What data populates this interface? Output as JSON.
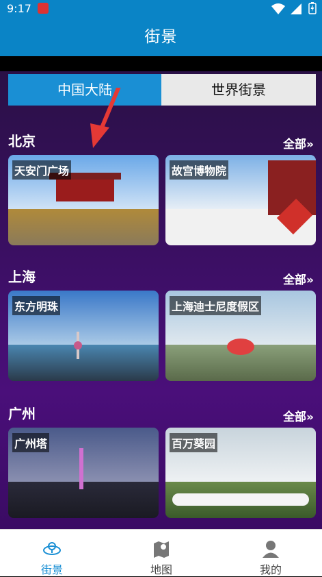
{
  "status_bar": {
    "time": "9:17"
  },
  "header": {
    "title": "街景"
  },
  "tabs": [
    {
      "label": "中国大陆",
      "active": true
    },
    {
      "label": "世界街景",
      "active": false
    }
  ],
  "sections": [
    {
      "city": "北京",
      "all_label": "全部»",
      "cards": [
        {
          "label": "天安门广场"
        },
        {
          "label": "故宫博物院"
        }
      ]
    },
    {
      "city": "上海",
      "all_label": "全部»",
      "cards": [
        {
          "label": "东方明珠"
        },
        {
          "label": "上海迪士尼度假区"
        }
      ]
    },
    {
      "city": "广州",
      "all_label": "全部»",
      "cards": [
        {
          "label": "广州塔"
        },
        {
          "label": "百万葵园"
        }
      ]
    }
  ],
  "bottom_nav": [
    {
      "label": "街景",
      "icon": "street-view-icon",
      "active": true
    },
    {
      "label": "地图",
      "icon": "map-icon",
      "active": false
    },
    {
      "label": "我的",
      "icon": "user-icon",
      "active": false
    }
  ],
  "colors": {
    "primary": "#0a84c6",
    "tab_active": "#1a8fd4",
    "content_bg": "#3b0f63"
  }
}
